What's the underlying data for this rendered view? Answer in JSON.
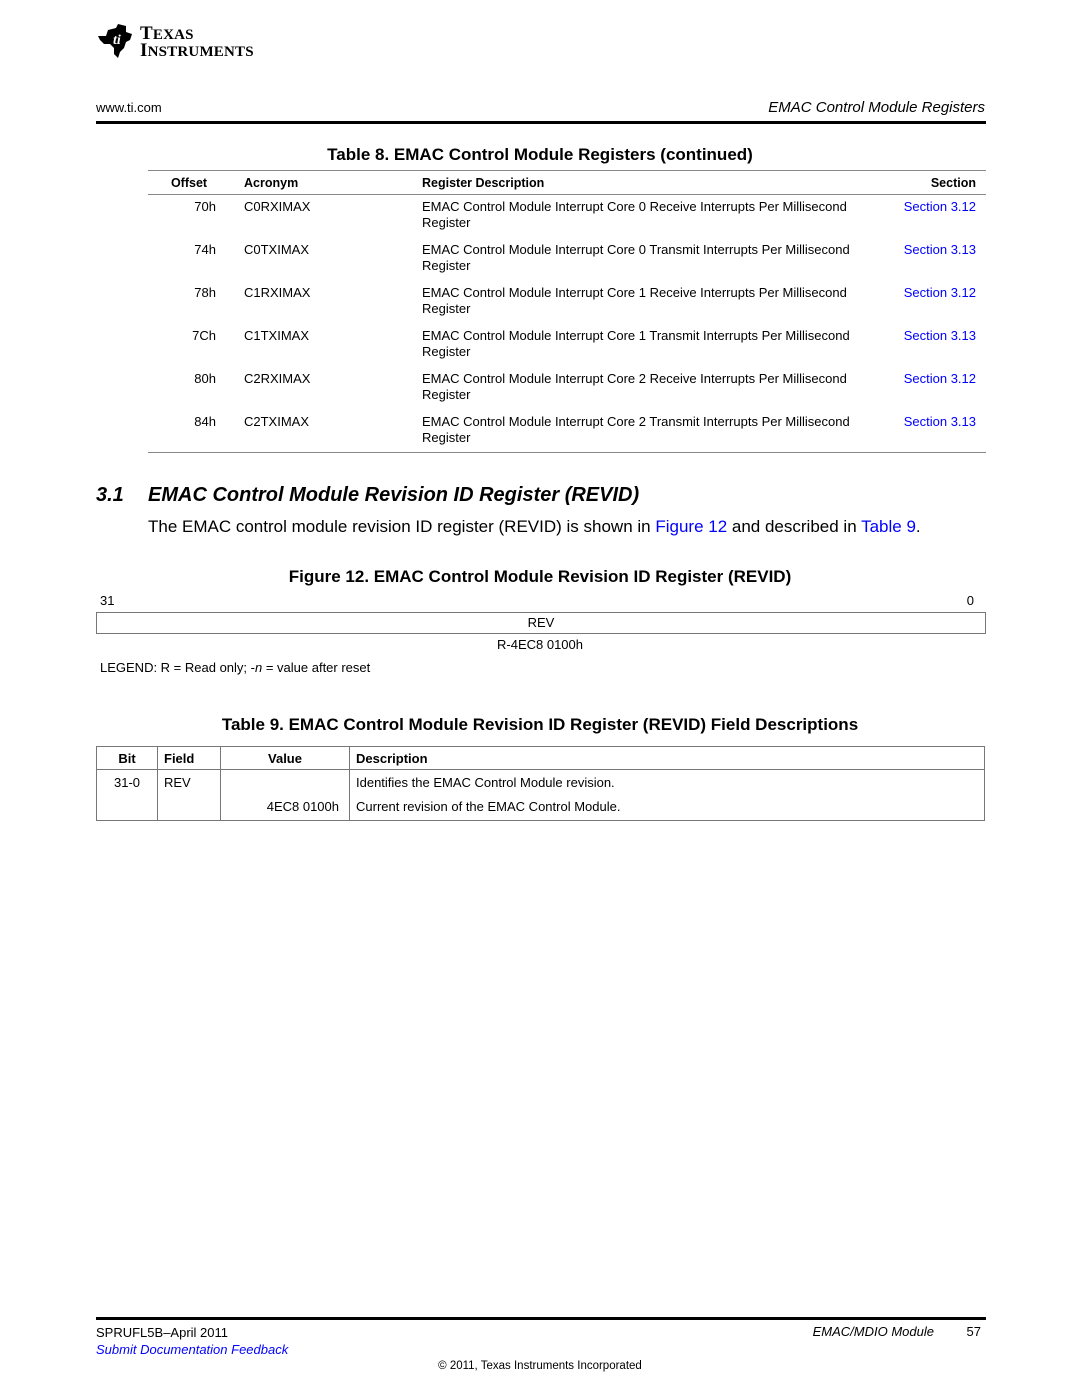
{
  "logo": {
    "line1": "Texas",
    "line2": "Instruments",
    "icon": "ti-logo-icon"
  },
  "header": {
    "url": "www.ti.com",
    "section_title": "EMAC Control Module Registers"
  },
  "table8": {
    "title": "Table 8. EMAC Control Module Registers  (continued)",
    "columns": [
      "Offset",
      "Acronym",
      "Register Description",
      "Section"
    ],
    "rows": [
      {
        "offset": "70h",
        "acronym": "C0RXIMAX",
        "description": "EMAC Control Module Interrupt Core 0 Receive Interrupts Per Millisecond Register",
        "section": "Section 3.12"
      },
      {
        "offset": "74h",
        "acronym": "C0TXIMAX",
        "description": "EMAC Control Module Interrupt Core 0 Transmit Interrupts Per Millisecond Register",
        "section": "Section 3.13"
      },
      {
        "offset": "78h",
        "acronym": "C1RXIMAX",
        "description": "EMAC Control Module Interrupt Core 1 Receive Interrupts Per Millisecond Register",
        "section": "Section 3.12"
      },
      {
        "offset": "7Ch",
        "acronym": "C1TXIMAX",
        "description": "EMAC Control Module Interrupt Core 1 Transmit Interrupts Per Millisecond Register",
        "section": "Section 3.13"
      },
      {
        "offset": "80h",
        "acronym": "C2RXIMAX",
        "description": "EMAC Control Module Interrupt Core 2 Receive Interrupts Per Millisecond Register",
        "section": "Section 3.12"
      },
      {
        "offset": "84h",
        "acronym": "C2TXIMAX",
        "description": "EMAC Control Module Interrupt Core 2 Transmit Interrupts Per Millisecond Register",
        "section": "Section 3.13"
      }
    ]
  },
  "section": {
    "number": "3.1",
    "title": "EMAC Control Module Revision ID Register (REVID)",
    "para_prefix": "The EMAC control module revision ID register (REVID) is shown in ",
    "para_link1": "Figure 12",
    "para_mid": " and described in ",
    "para_link2": "Table 9",
    "para_suffix": "."
  },
  "figure12": {
    "title": "Figure 12. EMAC Control Module Revision ID Register (REVID)",
    "bit_high": "31",
    "bit_low": "0",
    "field": "REV",
    "reset": "R-4EC8 0100h",
    "legend_prefix": "LEGEND: R = Read only; -",
    "legend_n": "n",
    "legend_suffix": " = value after reset"
  },
  "table9": {
    "title": "Table 9. EMAC Control Module Revision ID Register (REVID) Field Descriptions",
    "columns": [
      "Bit",
      "Field",
      "Value",
      "Description"
    ],
    "rows": [
      {
        "bit": "31-0",
        "field": "REV",
        "value": "",
        "description": "Identifies the EMAC Control Module revision."
      },
      {
        "bit": "",
        "field": "",
        "value": "4EC8 0100h",
        "description": "Current revision of the EMAC Control Module."
      }
    ]
  },
  "footer": {
    "doc_id": "SPRUFL5B–April 2011",
    "module": "EMAC/MDIO Module",
    "page": "57",
    "feedback": "Submit Documentation Feedback",
    "copyright": "© 2011, Texas Instruments Incorporated"
  }
}
